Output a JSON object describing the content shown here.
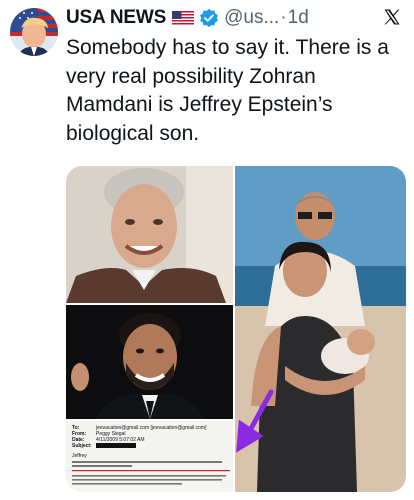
{
  "post": {
    "author_name": "USA NEWS",
    "flag_icon": "us-flag-icon",
    "verified_icon": "verified-badge-icon",
    "handle": "@us...",
    "separator": "·",
    "time": "1d",
    "text": "Somebody has to say it. There is a very real possibility Zohran Mamdani is Jeffrey Epstein’s biological son."
  },
  "media": {
    "photos": [
      "photo-man-in-sweater",
      "photo-smiling-man-in-suit",
      "photo-beach-woman-with-baby"
    ],
    "document": {
      "to_label": "To:",
      "from_label": "From:",
      "date_label": "Date:",
      "subject_label": "Subject:",
      "to_value": "jeevacation@gmail.com [jeevacation@gmail.com]",
      "from_value": "Peggy Siegal",
      "date_value": "4/11/2009 5:07:02 AM",
      "greeting": "Jeffrey"
    }
  },
  "colors": {
    "verified": "#1d9bf0",
    "arrow": "#8a2be2",
    "underline": "#cc2222"
  }
}
